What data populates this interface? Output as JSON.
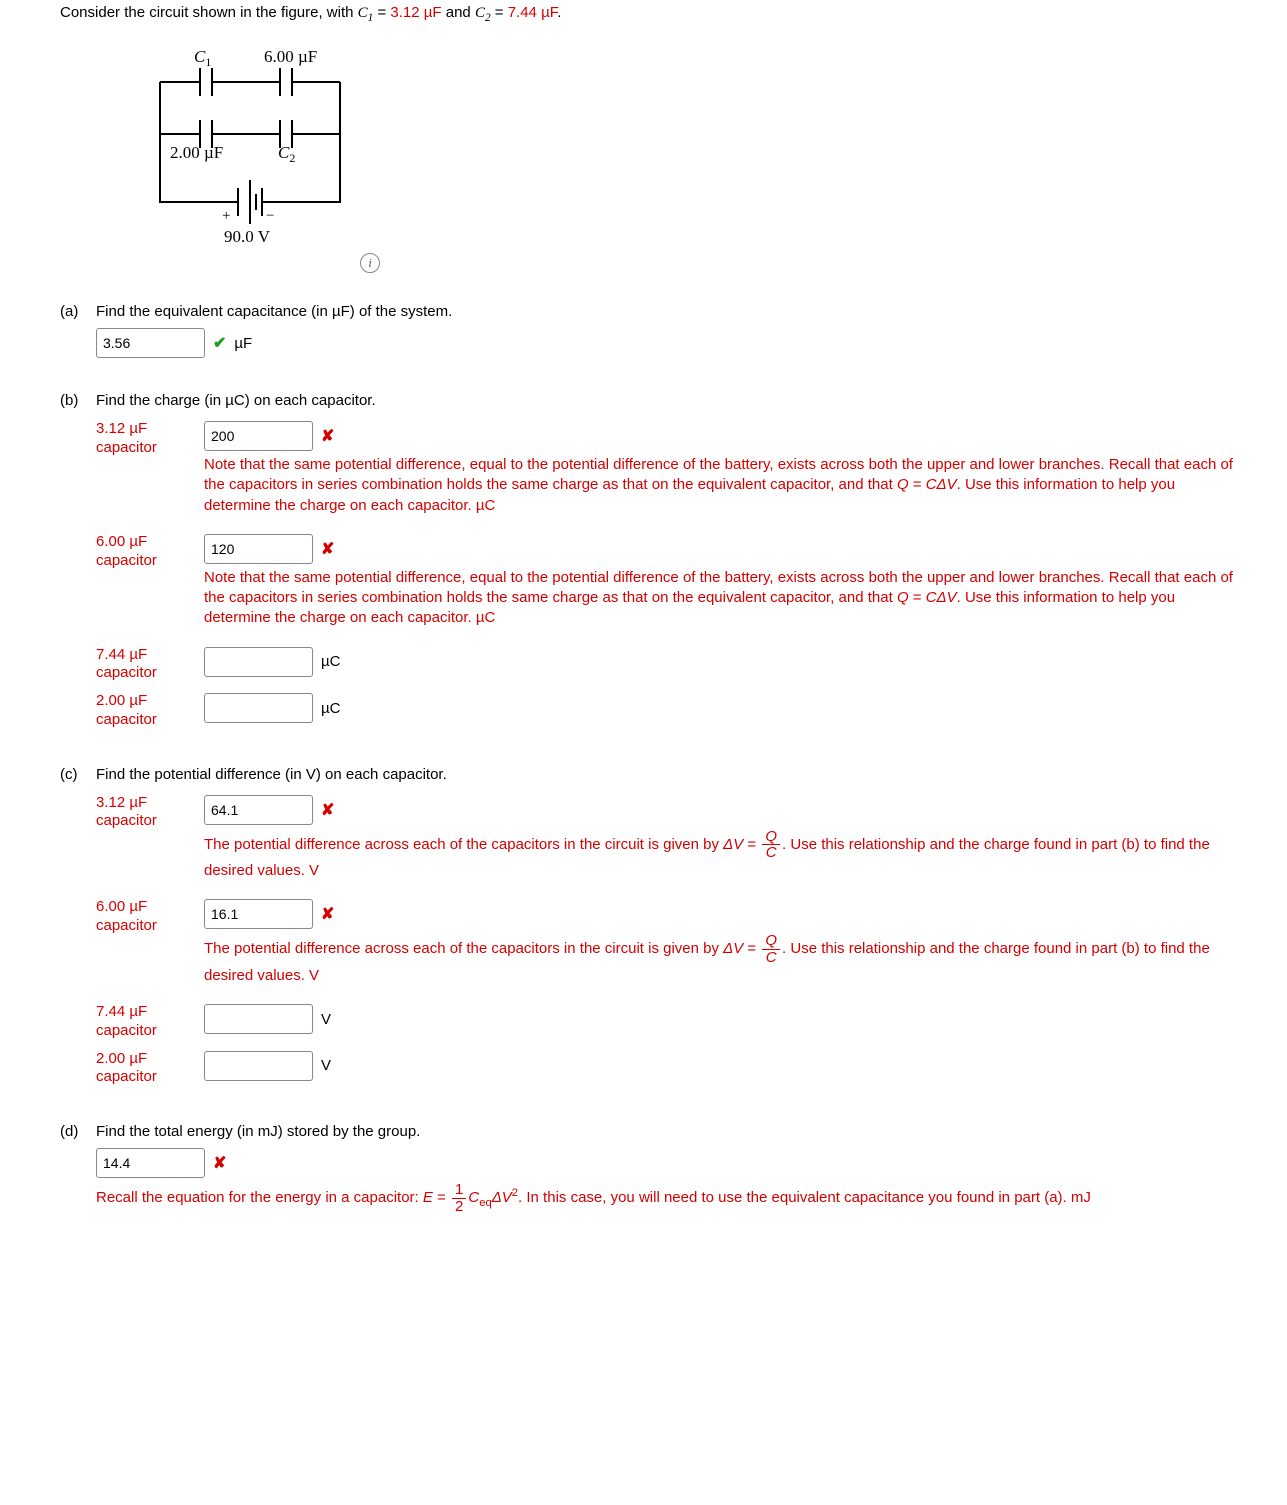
{
  "intro": {
    "prefix": "Consider the circuit shown in the figure, with ",
    "C1_val": "3.12 µF",
    "mid": " and ",
    "C2_val": "7.44 µF",
    "suffix": "."
  },
  "diagram": {
    "C1_label": "C",
    "C1_sub": "1",
    "top_right_label": "6.00 µF",
    "bottom_left_label": "2.00 µF",
    "C2_label": "C",
    "C2_sub": "2",
    "voltage_label": "90.0 V",
    "plus": "+",
    "minus": "−"
  },
  "parts": {
    "a": {
      "label": "(a)",
      "question": "Find the equivalent capacitance (in µF) of the system.",
      "value": "3.56",
      "unit": "µF",
      "status": "correct"
    },
    "b": {
      "label": "(b)",
      "question": "Find the charge (in µC) on each capacitor.",
      "feedback_series": "Note that the same potential difference, equal to the potential difference of the battery, exists across both the upper and lower branches. Recall that each of the capacitors in series combination holds the same charge as that on the equivalent capacitor, and that ",
      "feedback_qeq": ". Use this information to help you determine the charge on each capacitor. µC",
      "rows": [
        {
          "cap_label_val": "3.12 µF",
          "cap_label_word": "capacitor",
          "value": "200",
          "unit": "µC",
          "status": "wrong",
          "has_feedback": true
        },
        {
          "cap_label_val": "6.00 µF",
          "cap_label_word": "capacitor",
          "value": "120",
          "unit": "µC",
          "status": "wrong",
          "has_feedback": true
        },
        {
          "cap_label_val": "7.44 µF",
          "cap_label_word": "capacitor",
          "value": "",
          "unit": "µC",
          "status": "none",
          "has_feedback": false
        },
        {
          "cap_label_val": "2.00 µF",
          "cap_label_word": "capacitor",
          "value": "",
          "unit": "µC",
          "status": "none",
          "has_feedback": false
        }
      ]
    },
    "c": {
      "label": "(c)",
      "question": "Find the potential difference (in V) on each capacitor.",
      "feedback_pd1": "The potential difference across each of the capacitors in the circuit is given by ",
      "feedback_pd2": ". Use this relationship and the charge found in part (b) to find the desired values. V",
      "rows": [
        {
          "cap_label_val": "3.12 µF",
          "cap_label_word": "capacitor",
          "value": "64.1",
          "unit": "V",
          "status": "wrong",
          "has_feedback": true
        },
        {
          "cap_label_val": "6.00 µF",
          "cap_label_word": "capacitor",
          "value": "16.1",
          "unit": "V",
          "status": "wrong",
          "has_feedback": true
        },
        {
          "cap_label_val": "7.44 µF",
          "cap_label_word": "capacitor",
          "value": "",
          "unit": "V",
          "status": "none",
          "has_feedback": false
        },
        {
          "cap_label_val": "2.00 µF",
          "cap_label_word": "capacitor",
          "value": "",
          "unit": "V",
          "status": "none",
          "has_feedback": false
        }
      ]
    },
    "d": {
      "label": "(d)",
      "question": "Find the total energy (in mJ) stored by the group.",
      "value": "14.4",
      "unit": "mJ",
      "status": "wrong",
      "feedback_pre": "Recall the equation for the energy in a capacitor: ",
      "feedback_post": ". In this case, you will need to use the equivalent capacitance you found in part (a). mJ"
    }
  },
  "math": {
    "Q": "Q",
    "C": "C",
    "DeltaV": "ΔV",
    "E": "E",
    "eq_sub": "eq",
    "equals": " = ",
    "half_num": "1",
    "half_den": "2",
    "sq": "2"
  }
}
